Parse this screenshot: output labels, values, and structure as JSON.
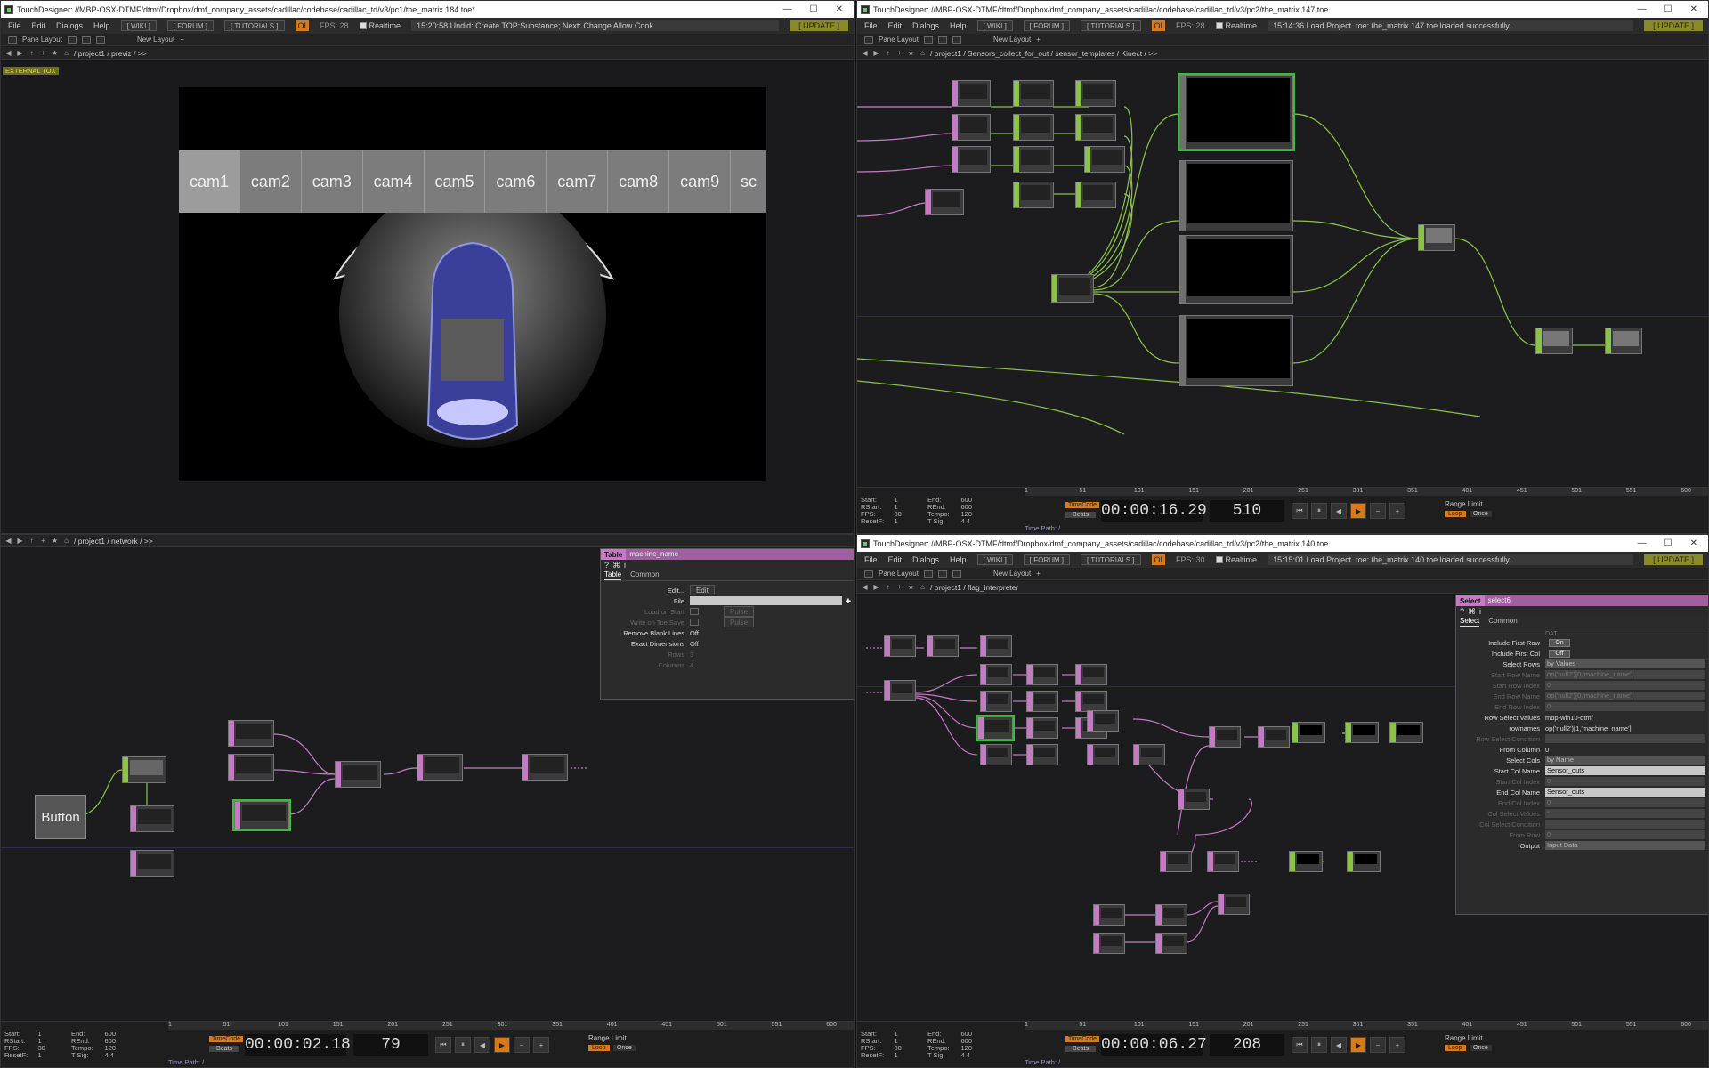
{
  "windows": {
    "tl": {
      "title": "TouchDesigner: //MBP-OSX-DTMF/dtmf/Dropbox/dmf_company_assets/cadillac/codebase/cadillac_td/v3/pc1/the_matrix.184.toe*",
      "fps": "FPS:  28",
      "message": "15:20:58 Undid: Create TOP:Substance; Next: Change Allow Cook",
      "path": "/ project1 / previz / >>",
      "badge": "EXTERNAL TOX",
      "cams": [
        "cam1",
        "cam2",
        "cam3",
        "cam4",
        "cam5",
        "cam6",
        "cam7",
        "cam8",
        "cam9",
        "sc"
      ]
    },
    "tr": {
      "title": "TouchDesigner: //MBP-OSX-DTMF/dtmf/Dropbox/dmf_company_assets/cadillac/codebase/cadillac_td/v3/pc2/the_matrix.147.toe",
      "fps": "FPS:  28",
      "message": "15:14:36 Load Project .toe: the_matrix.147.toe loaded successfully.",
      "path": "/ project1 / Sensors_collect_for_out / sensor_templates / Kinect / >>",
      "timeline": {
        "start": "1",
        "end": "600",
        "rstart": "1",
        "rend": "600",
        "fps": "30",
        "tempo": "120",
        "resetf": "1",
        "tsig": "4      4",
        "time": "00:00:16.29",
        "frame": "510"
      }
    },
    "bl": {
      "path": "/ project1 / network / >>",
      "button_label": "Button",
      "timeline": {
        "start": "1",
        "end": "600",
        "rstart": "1",
        "rend": "600",
        "fps": "30",
        "tempo": "120",
        "resetf": "1",
        "tsig": "4      4",
        "time": "00:00:02.18",
        "frame": "79"
      },
      "param": {
        "type": "Table",
        "name": "machine_name",
        "tabs": [
          "Table",
          "Common"
        ],
        "rows": [
          {
            "label": "Edit...",
            "value": "Edit"
          },
          {
            "label": "File",
            "value": ""
          },
          {
            "label": "Load on Start",
            "value": "Pulse"
          },
          {
            "label": "Write on Toe Save",
            "value": "Pulse"
          },
          {
            "label": "Remove Blank Lines",
            "value": "Off"
          },
          {
            "label": "Exact Dimensions",
            "value": "Off"
          },
          {
            "label": "Rows",
            "value": "3"
          },
          {
            "label": "Columns",
            "value": "4"
          }
        ]
      }
    },
    "br": {
      "title": "TouchDesigner: //MBP-OSX-DTMF/dtmf/Dropbox/dmf_company_assets/cadillac/codebase/cadillac_td/v3/pc2/the_matrix.140.toe",
      "fps": "FPS:  30",
      "message": "15:15:01 Load Project .toe: the_matrix.140.toe loaded successfully.",
      "path": "/ project1 / flag_interpreter",
      "timeline": {
        "start": "1",
        "end": "600",
        "rstart": "1",
        "rend": "600",
        "fps": "30",
        "tempo": "120",
        "resetf": "1",
        "tsig": "4      4",
        "time": "00:00:06.27",
        "frame": "208"
      },
      "param": {
        "type": "Select",
        "name": "select6",
        "tabs": [
          "Select",
          "Common"
        ],
        "section": "DAT",
        "rows": [
          {
            "label": "Include First Row",
            "value": "On",
            "kind": "tog"
          },
          {
            "label": "Include First Col",
            "value": "Off",
            "kind": "tog"
          },
          {
            "label": "Select Rows",
            "value": "by Values",
            "kind": "drop"
          },
          {
            "label": "Start Row Name",
            "value": "op('null2')[0,'machine_name']",
            "kind": "dim"
          },
          {
            "label": "Start Row Index",
            "value": "0",
            "kind": "dim"
          },
          {
            "label": "End Row Name",
            "value": "op('null2')[0,'machine_name']",
            "kind": "dim"
          },
          {
            "label": "End Row Index",
            "value": "0",
            "kind": "dim"
          },
          {
            "label": "Row Select Values",
            "value": "mbp-win10-dtmf",
            "kind": "text"
          },
          {
            "label": "rownames",
            "value": "op('null2')[1,'machine_name']",
            "kind": "text"
          },
          {
            "label": "Row Select Condition",
            "value": "",
            "kind": "dim"
          },
          {
            "label": "From Column",
            "value": "0",
            "kind": "text"
          },
          {
            "label": "Select Cols",
            "value": "by Name",
            "kind": "drop"
          },
          {
            "label": "Start Col Name",
            "value": "Sensor_outs",
            "kind": "field"
          },
          {
            "label": "Start Col Index",
            "value": "0",
            "kind": "dim"
          },
          {
            "label": "End Col Name",
            "value": "Sensor_outs",
            "kind": "field"
          },
          {
            "label": "End Col Index",
            "value": "0",
            "kind": "dim"
          },
          {
            "label": "Col Select Values",
            "value": "*",
            "kind": "dim"
          },
          {
            "label": "Col Select Condition",
            "value": "",
            "kind": "dim"
          },
          {
            "label": "From Row",
            "value": "0",
            "kind": "dim"
          },
          {
            "label": "Output",
            "value": "Input Data",
            "kind": "drop"
          }
        ]
      }
    }
  },
  "menu": {
    "file": "File",
    "edit": "Edit",
    "dialogs": "Dialogs",
    "help": "Help",
    "wiki": "[ WIKI ]",
    "forum": "[ FORUM ]",
    "tutorials": "[ TUTORIALS ]",
    "oi": "OI",
    "realtime": "Realtime",
    "update": "[ UPDATE ]"
  },
  "panebar": {
    "pane_layout": "Pane Layout",
    "new_layout": "New Layout"
  },
  "timeline_labels": {
    "start": "Start:",
    "end": "End:",
    "rstart": "RStart:",
    "rend": "REnd:",
    "fps": "FPS:",
    "tempo": "Tempo:",
    "resetf": "ResetF:",
    "tsig": "T Sig:",
    "timecode": "TimeCode",
    "beats": "Beats",
    "range_limit": "Range Limit",
    "loop": "Loop",
    "once": "Once",
    "time_path": "Time Path: /"
  },
  "ruler_ticks": [
    "1",
    "51",
    "101",
    "151",
    "201",
    "251",
    "301",
    "351",
    "401",
    "451",
    "501",
    "551",
    "600"
  ],
  "colors": {
    "dat": "#c47bc4",
    "chop": "#8bc34a",
    "accent": "#d77a1a",
    "selected": "#3dbb3d"
  }
}
